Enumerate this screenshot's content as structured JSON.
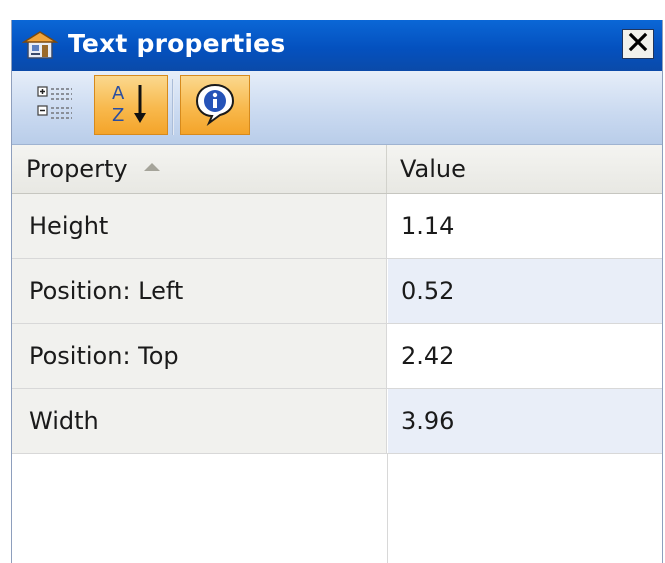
{
  "window": {
    "title": "Text properties",
    "title_icon": "properties-window-icon",
    "close_icon": "close-icon"
  },
  "toolbar": {
    "buttons": [
      {
        "name": "categorized-view",
        "icon": "categorized-icon",
        "active": false
      },
      {
        "name": "alphabetical-sort",
        "icon": "sort-az-icon",
        "active": true
      },
      {
        "name": "info",
        "icon": "info-icon",
        "active": true
      }
    ]
  },
  "grid": {
    "columns": {
      "property": "Property",
      "value": "Value"
    },
    "sort": "ascending",
    "rows": [
      {
        "property": "Height",
        "value": "1.14"
      },
      {
        "property": "Position: Left",
        "value": "0.52"
      },
      {
        "property": "Position: Top",
        "value": "2.42"
      },
      {
        "property": "Width",
        "value": "3.96"
      }
    ]
  },
  "colors": {
    "titlebar": "#0451bf",
    "toolbar": "#c9d9f0",
    "active_button": "#f8b94d",
    "alt_row": "#e9eef8"
  }
}
